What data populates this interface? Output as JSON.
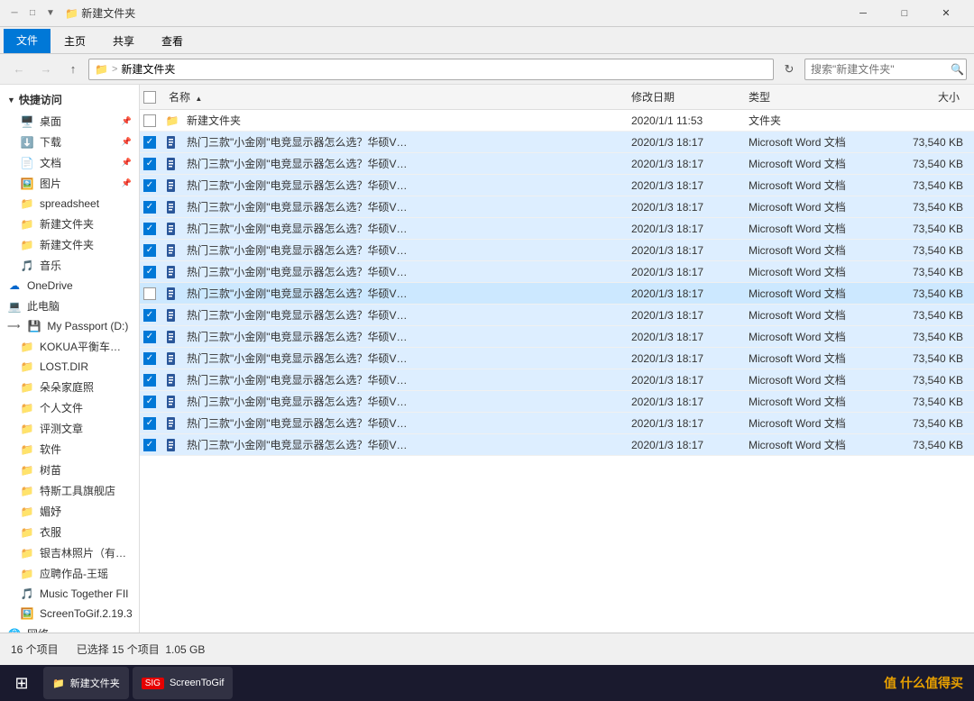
{
  "titleBar": {
    "title": "新建文件夹",
    "icons": [
      "─",
      "□",
      "✕"
    ]
  },
  "ribbonTabs": [
    {
      "label": "文件",
      "active": true
    },
    {
      "label": "主页",
      "active": false
    },
    {
      "label": "共享",
      "active": false
    },
    {
      "label": "查看",
      "active": false
    }
  ],
  "addressBar": {
    "path": "新建文件夹",
    "breadcrumb": "> 新建文件夹",
    "searchPlaceholder": "搜索\"新建文件夹\"",
    "refreshSymbol": "↻"
  },
  "sidebar": {
    "quickAccessLabel": "快捷访问",
    "items": [
      {
        "label": "桌面",
        "icon": "🖥️",
        "pinned": true
      },
      {
        "label": "下载",
        "icon": "⬇️",
        "pinned": true
      },
      {
        "label": "文档",
        "icon": "📄",
        "pinned": true
      },
      {
        "label": "图片",
        "icon": "🖼️",
        "pinned": true
      },
      {
        "label": "spreadsheet",
        "icon": "📁"
      },
      {
        "label": "新建文件夹",
        "icon": "📁"
      },
      {
        "label": "新建文件夹",
        "icon": "📁"
      },
      {
        "label": "音乐",
        "icon": "🎵"
      },
      {
        "label": "OneDrive",
        "icon": "☁️"
      },
      {
        "label": "此电脑",
        "icon": "💻"
      },
      {
        "label": "My Passport (D:)",
        "icon": "💾"
      },
      {
        "label": "KOKUA平衡车相关…",
        "icon": "📁"
      },
      {
        "label": "LOST.DIR",
        "icon": "📁"
      },
      {
        "label": "朵朵家庭照",
        "icon": "📁"
      },
      {
        "label": "个人文件",
        "icon": "📁"
      },
      {
        "label": "评测文章",
        "icon": "📁"
      },
      {
        "label": "软件",
        "icon": "📁"
      },
      {
        "label": "树苗",
        "icon": "📁"
      },
      {
        "label": "特斯工具旗舰店",
        "icon": "📁"
      },
      {
        "label": "媚妤",
        "icon": "📁"
      },
      {
        "label": "衣服",
        "icon": "📁"
      },
      {
        "label": "银吉林照片（有米…",
        "icon": "📁"
      },
      {
        "label": "应聘作品-王瑶",
        "icon": "📁"
      },
      {
        "label": "Music Together FII",
        "icon": "🎵"
      },
      {
        "label": "ScreenToGif.2.19.3",
        "icon": "🖼️"
      },
      {
        "label": "网络",
        "icon": "🌐"
      }
    ]
  },
  "fileList": {
    "columns": [
      {
        "label": "名称",
        "sortable": true,
        "hasArrow": true
      },
      {
        "label": "修改日期",
        "sortable": true
      },
      {
        "label": "类型",
        "sortable": true
      },
      {
        "label": "大小",
        "sortable": true
      }
    ],
    "files": [
      {
        "name": "新建文件夹",
        "date": "2020/1/1 11:53",
        "type": "文件夹",
        "size": "",
        "isFolder": true,
        "checked": false
      },
      {
        "name": "热门三款\"小金刚\"电竞显示器怎么选？华硕V…",
        "date": "2020/1/3 18:17",
        "type": "Microsoft Word 文档",
        "size": "73,540 KB",
        "isFolder": false,
        "checked": true
      },
      {
        "name": "热门三款\"小金刚\"电竞显示器怎么选？华硕V…",
        "date": "2020/1/3 18:17",
        "type": "Microsoft Word 文档",
        "size": "73,540 KB",
        "isFolder": false,
        "checked": true
      },
      {
        "name": "热门三款\"小金刚\"电竞显示器怎么选？华硕V…",
        "date": "2020/1/3 18:17",
        "type": "Microsoft Word 文档",
        "size": "73,540 KB",
        "isFolder": false,
        "checked": true
      },
      {
        "name": "热门三款\"小金刚\"电竞显示器怎么选？华硕V…",
        "date": "2020/1/3 18:17",
        "type": "Microsoft Word 文档",
        "size": "73,540 KB",
        "isFolder": false,
        "checked": true
      },
      {
        "name": "热门三款\"小金刚\"电竞显示器怎么选？华硕V…",
        "date": "2020/1/3 18:17",
        "type": "Microsoft Word 文档",
        "size": "73,540 KB",
        "isFolder": false,
        "checked": true
      },
      {
        "name": "热门三款\"小金刚\"电竞显示器怎么选？华硕V…",
        "date": "2020/1/3 18:17",
        "type": "Microsoft Word 文档",
        "size": "73,540 KB",
        "isFolder": false,
        "checked": true
      },
      {
        "name": "热门三款\"小金刚\"电竞显示器怎么选？华硕V…",
        "date": "2020/1/3 18:17",
        "type": "Microsoft Word 文档",
        "size": "73,540 KB",
        "isFolder": false,
        "checked": true
      },
      {
        "name": "热门三款\"小金刚\"电竞显示器怎么选？华硕V…",
        "date": "2020/1/3 18:17",
        "type": "Microsoft Word 文档",
        "size": "73,540 KB",
        "isFolder": false,
        "checked": false,
        "selected": true
      },
      {
        "name": "热门三款\"小金刚\"电竞显示器怎么选？华硕V…",
        "date": "2020/1/3 18:17",
        "type": "Microsoft Word 文档",
        "size": "73,540 KB",
        "isFolder": false,
        "checked": true
      },
      {
        "name": "热门三款\"小金刚\"电竞显示器怎么选？华硕V…",
        "date": "2020/1/3 18:17",
        "type": "Microsoft Word 文档",
        "size": "73,540 KB",
        "isFolder": false,
        "checked": true
      },
      {
        "name": "热门三款\"小金刚\"电竞显示器怎么选？华硕V…",
        "date": "2020/1/3 18:17",
        "type": "Microsoft Word 文档",
        "size": "73,540 KB",
        "isFolder": false,
        "checked": true
      },
      {
        "name": "热门三款\"小金刚\"电竞显示器怎么选？华硕V…",
        "date": "2020/1/3 18:17",
        "type": "Microsoft Word 文档",
        "size": "73,540 KB",
        "isFolder": false,
        "checked": true
      },
      {
        "name": "热门三款\"小金刚\"电竞显示器怎么选？华硕V…",
        "date": "2020/1/3 18:17",
        "type": "Microsoft Word 文档",
        "size": "73,540 KB",
        "isFolder": false,
        "checked": true
      },
      {
        "name": "热门三款\"小金刚\"电竞显示器怎么选？华硕V…",
        "date": "2020/1/3 18:17",
        "type": "Microsoft Word 文档",
        "size": "73,540 KB",
        "isFolder": false,
        "checked": true
      },
      {
        "name": "热门三款\"小金刚\"电竞显示器怎么选？华硕V…",
        "date": "2020/1/3 18:17",
        "type": "Microsoft Word 文档",
        "size": "73,540 KB",
        "isFolder": false,
        "checked": true
      }
    ]
  },
  "statusBar": {
    "itemCount": "16 个项目",
    "selectedCount": "已选择 15 个项目",
    "selectedSize": "1.05 GB"
  },
  "taskbar": {
    "startIcon": "⊞",
    "items": [
      {
        "label": "新建文件夹",
        "icon": "📁"
      },
      {
        "label": "ScreenToGif",
        "icon": "🎬"
      }
    ],
    "watermark": "值 什么值得买"
  }
}
